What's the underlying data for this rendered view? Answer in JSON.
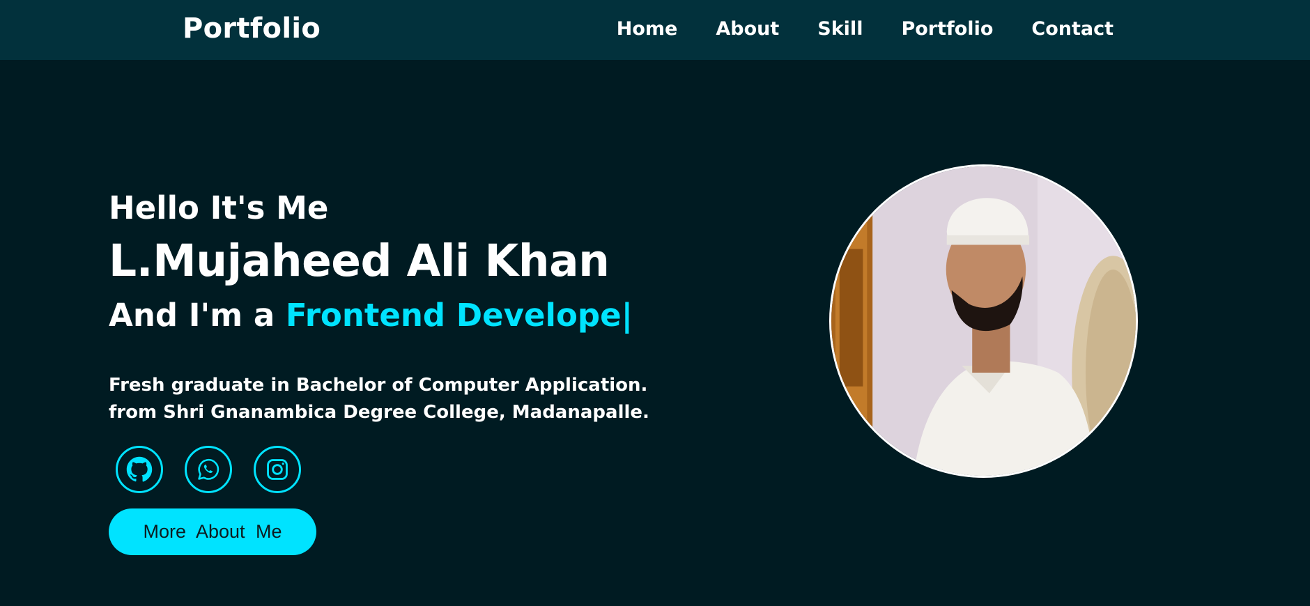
{
  "nav": {
    "logo": "Portfolio",
    "links": [
      "Home",
      "About",
      "Skill",
      "Portfolio",
      "Contact"
    ]
  },
  "hero": {
    "greeting": "Hello It's Me",
    "name": "L.Mujaheed Ali Khan",
    "role_prefix": "And I'm a ",
    "role_typed": "Frontend Develope",
    "caret": "|",
    "bio_line1": "Fresh graduate in Bachelor of Computer Application.",
    "bio_line2": "from Shri Gnanambica Degree College, Madanapalle.",
    "cta_label": "More  About  Me"
  },
  "socials": [
    {
      "icon": "github-icon"
    },
    {
      "icon": "whatsapp-icon"
    },
    {
      "icon": "instagram-icon"
    }
  ],
  "colors": {
    "background": "#001b22",
    "navbar": "#02313c",
    "accent": "#00e3ff",
    "text": "#ffffff"
  }
}
